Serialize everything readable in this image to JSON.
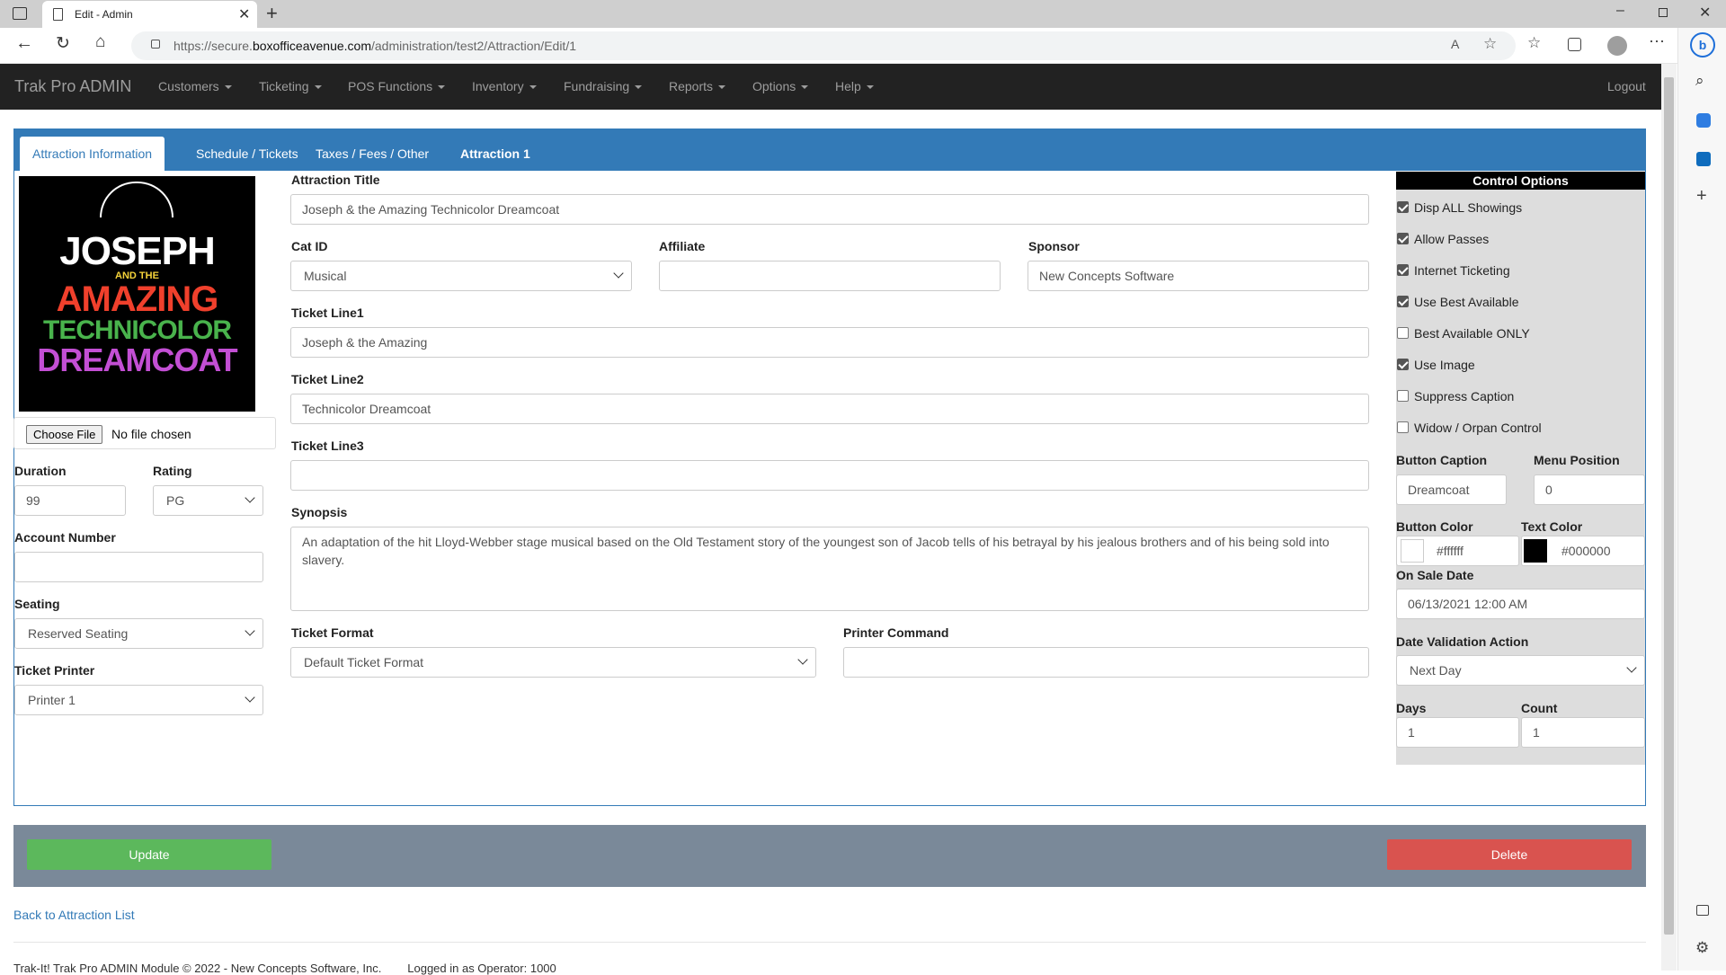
{
  "browser": {
    "tab_title": "Edit - Admin",
    "url_prefix": "https://secure.",
    "url_domain": "boxofficeavenue.com",
    "url_path": "/administration/test2/Attraction/Edit/1"
  },
  "navbar": {
    "brand": "Trak Pro ADMIN",
    "items": [
      "Customers",
      "Ticketing",
      "POS Functions",
      "Inventory",
      "Fundraising",
      "Reports",
      "Options",
      "Help"
    ],
    "logout": "Logout"
  },
  "tabs": [
    "Attraction Information",
    "Schedule / Tickets",
    "Taxes / Fees / Other",
    "Attraction 1"
  ],
  "image": {
    "lines": [
      "JOSEPH",
      "AND THE",
      "AMAZING",
      "TECHNICOLOR",
      "DREAMCOAT"
    ],
    "choose_file": "Choose File",
    "no_file": "No file chosen"
  },
  "left": {
    "duration_label": "Duration",
    "duration_value": "99",
    "rating_label": "Rating",
    "rating_value": "PG",
    "account_label": "Account Number",
    "account_value": "",
    "seating_label": "Seating",
    "seating_value": "Reserved Seating",
    "printer_label": "Ticket Printer",
    "printer_value": "Printer 1"
  },
  "form": {
    "title_label": "Attraction Title",
    "title_value": "Joseph & the Amazing Technicolor Dreamcoat",
    "catid_label": "Cat ID",
    "catid_value": "Musical",
    "affiliate_label": "Affiliate",
    "affiliate_value": "",
    "sponsor_label": "Sponsor",
    "sponsor_value": "New Concepts Software",
    "line1_label": "Ticket Line1",
    "line1_value": "Joseph & the Amazing",
    "line2_label": "Ticket Line2",
    "line2_value": "Technicolor Dreamcoat",
    "line3_label": "Ticket Line3",
    "line3_value": "",
    "synopsis_label": "Synopsis",
    "synopsis_value": "An adaptation of the hit Lloyd-Webber stage musical based on the Old Testament story of the youngest son of Jacob tells of his betrayal by his jealous brothers and of his being sold into slavery.",
    "format_label": "Ticket Format",
    "format_value": "Default Ticket Format",
    "printer_cmd_label": "Printer Command",
    "printer_cmd_value": ""
  },
  "control": {
    "header": "Control Options",
    "options": [
      {
        "label": "Disp ALL Showings",
        "checked": true
      },
      {
        "label": "Allow Passes",
        "checked": true
      },
      {
        "label": "Internet Ticketing",
        "checked": true
      },
      {
        "label": "Use Best Available",
        "checked": true
      },
      {
        "label": "Best Available ONLY",
        "checked": false
      },
      {
        "label": "Use Image",
        "checked": true
      },
      {
        "label": "Suppress Caption",
        "checked": false
      },
      {
        "label": "Widow / Orpan Control",
        "checked": false
      }
    ],
    "button_caption_label": "Button Caption",
    "button_caption_value": "Dreamcoat",
    "menu_position_label": "Menu Position",
    "menu_position_value": "0",
    "button_color_label": "Button Color",
    "button_color_value": "#ffffff",
    "text_color_label": "Text Color",
    "text_color_value": "#000000",
    "onsale_label": "On Sale Date",
    "onsale_value": "06/13/2021 12:00 AM",
    "date_action_label": "Date Validation Action",
    "date_action_value": "Next Day",
    "days_label": "Days",
    "days_value": "1",
    "count_label": "Count",
    "count_value": "1"
  },
  "actions": {
    "update": "Update",
    "delete": "Delete",
    "back_link": "Back to Attraction List"
  },
  "footer": {
    "text": "Trak-It! Trak Pro ADMIN Module © 2022 - New Concepts Software, Inc.        Logged in as Operator: 1000"
  },
  "colors": {
    "navbar": "#222222",
    "tab_strip": "#337ab7",
    "update": "#5cb85c",
    "delete": "#d9534f",
    "action_bar": "#7a8999"
  }
}
